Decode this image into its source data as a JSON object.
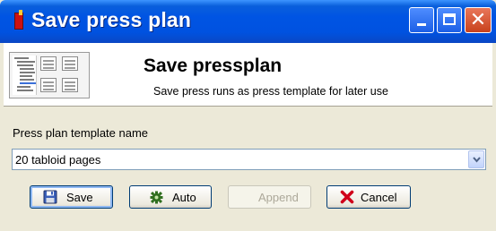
{
  "window": {
    "title": "Save press plan",
    "controls": {
      "minimize": "minimize-icon",
      "maximize": "maximize-icon",
      "close": "close-icon"
    }
  },
  "header": {
    "title": "Save pressplan",
    "subtitle": "Save press runs as press template for later use",
    "image": "press-plan-thumbnail"
  },
  "form": {
    "label": "Press plan template name",
    "value": "20 tabloid pages"
  },
  "buttons": {
    "save": {
      "label": "Save",
      "icon": "floppy-disk-icon"
    },
    "auto": {
      "label": "Auto",
      "icon": "gear-icon"
    },
    "append": {
      "label": "Append",
      "disabled": true
    },
    "cancel": {
      "label": "Cancel",
      "icon": "red-x-icon"
    }
  },
  "colors": {
    "titlebar": "#0054e3",
    "dialog_bg": "#ece9d8",
    "close_button": "#c8421c",
    "cancel_x": "#d0021b"
  }
}
